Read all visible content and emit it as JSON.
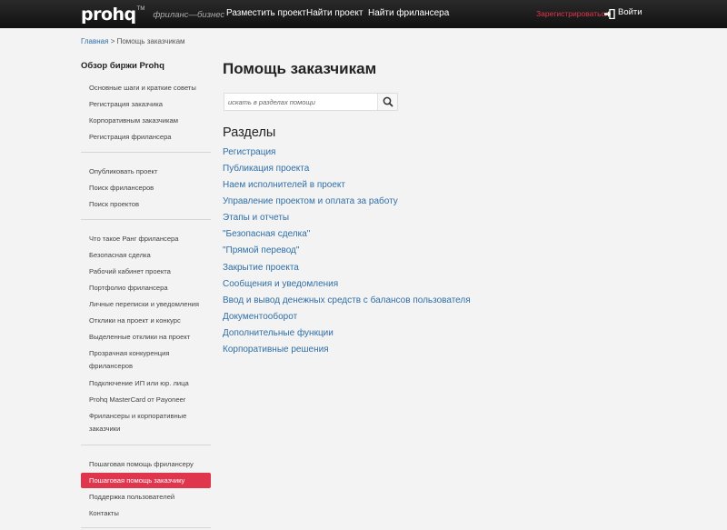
{
  "header": {
    "logo": "prohq",
    "logo_tm": "TM",
    "tagline": "фриланс—бизнес",
    "nav": [
      "Разместить проект",
      "Найти проект",
      "Найти фрилансера"
    ],
    "register": "Зарегистрироваться",
    "login": "Войти"
  },
  "breadcrumb": {
    "home": "Главная",
    "separator": ">",
    "current": "Помощь заказчикам"
  },
  "sidebar": {
    "title": "Обзор биржи Prohq",
    "group1": [
      "Основные шаги и краткие советы",
      "Регистрация заказчика",
      "Корпоративным заказчикам",
      "Регистрация фрилансера"
    ],
    "group2": [
      "Опубликовать проект",
      "Поиск фрилансеров",
      "Поиск проектов"
    ],
    "group3": [
      "Что такое Ранг фрилансера",
      "Безопасная сделка",
      "Рабочий кабинет проекта",
      "Портфолио фрилансера",
      "Личные переписки и уведомления",
      "Отклики на проект и конкурс",
      "Выделенные отклики на проект"
    ],
    "transparent_line1": "Прозрачная конкуренция",
    "transparent_line2": "фрилансеров",
    "group3b": [
      "Подключение ИП или юр. лица",
      "Prohq MasterCard от Payoneer"
    ],
    "corp_line1": "Фрилансеры и корпоративные",
    "corp_line2": "заказчики",
    "group4": [
      "Пошаговая помощь фрилансеру",
      "Пошаговая помощь заказчику",
      "Поддержка пользователей",
      "Контакты"
    ]
  },
  "main": {
    "title": "Помощь заказчикам",
    "search_placeholder": "искать в разделах помощи",
    "sections_title": "Разделы",
    "sections": [
      "Регистрация",
      "Публикация проекта",
      "Наем исполнителей в проект",
      "Управление проектом и оплата за работу",
      "Этапы и отчеты",
      "\"Безопасная сделка\"",
      "\"Прямой перевод\"",
      "Закрытие проекта",
      "Сообщения и уведомления",
      "Ввод и вывод денежных средств с балансов пользователя",
      "Документооборот",
      "Дополнительные функции",
      "Корпоративные решения"
    ]
  },
  "colors": {
    "accent": "#e0364d",
    "link": "#2f6fa7",
    "header_bg": "#1a1a1a",
    "page_bg": "#f3f3f3"
  },
  "icons": [
    "login-icon",
    "search-icon"
  ]
}
